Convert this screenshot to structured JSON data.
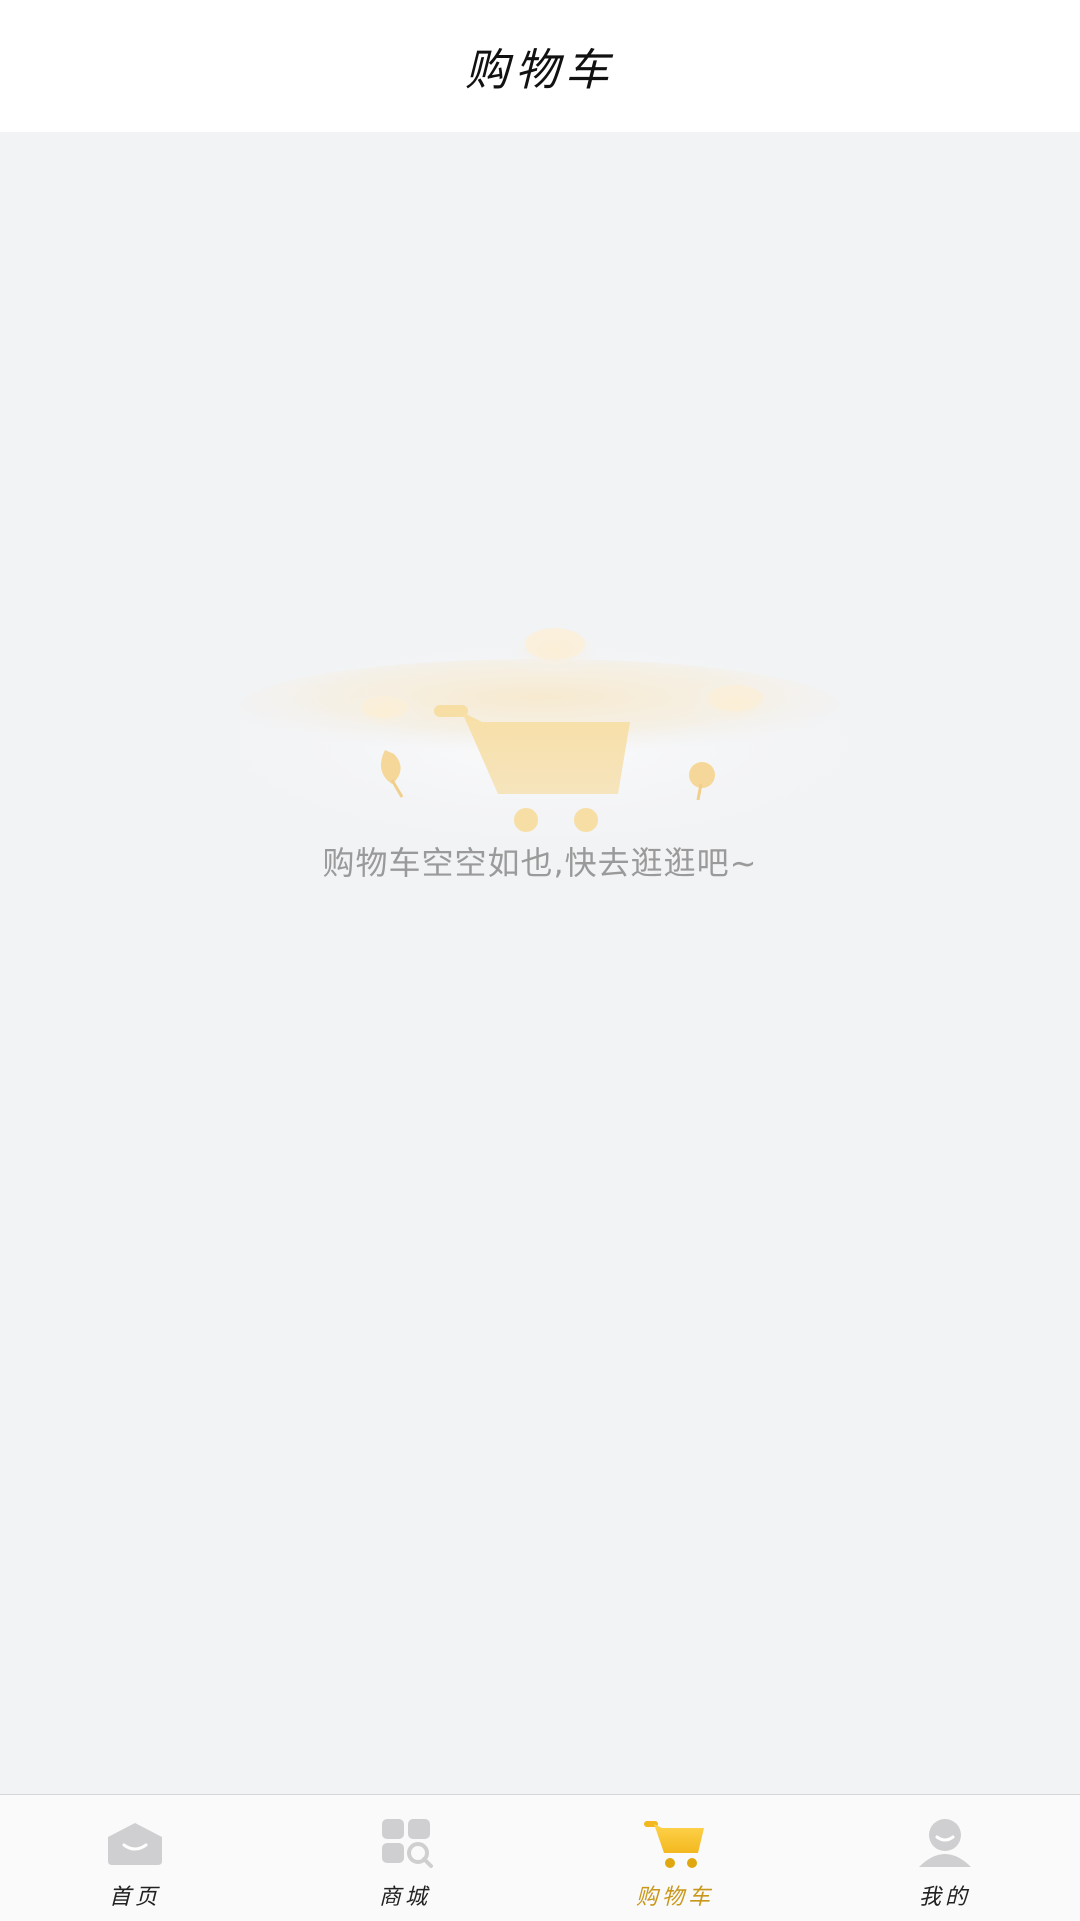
{
  "header": {
    "title": "购物车"
  },
  "empty_state": {
    "message": "购物车空空如也,快去逛逛吧~",
    "illustration_icon": "empty-cart-illustration"
  },
  "tabbar": {
    "active_color": "#c9971a",
    "inactive_color": "#c8c8c8",
    "items": [
      {
        "label": "首页",
        "icon": "home-icon",
        "active": false
      },
      {
        "label": "商城",
        "icon": "mall-icon",
        "active": false
      },
      {
        "label": "购物车",
        "icon": "cart-icon",
        "active": true
      },
      {
        "label": "我的",
        "icon": "profile-icon",
        "active": false
      }
    ]
  }
}
